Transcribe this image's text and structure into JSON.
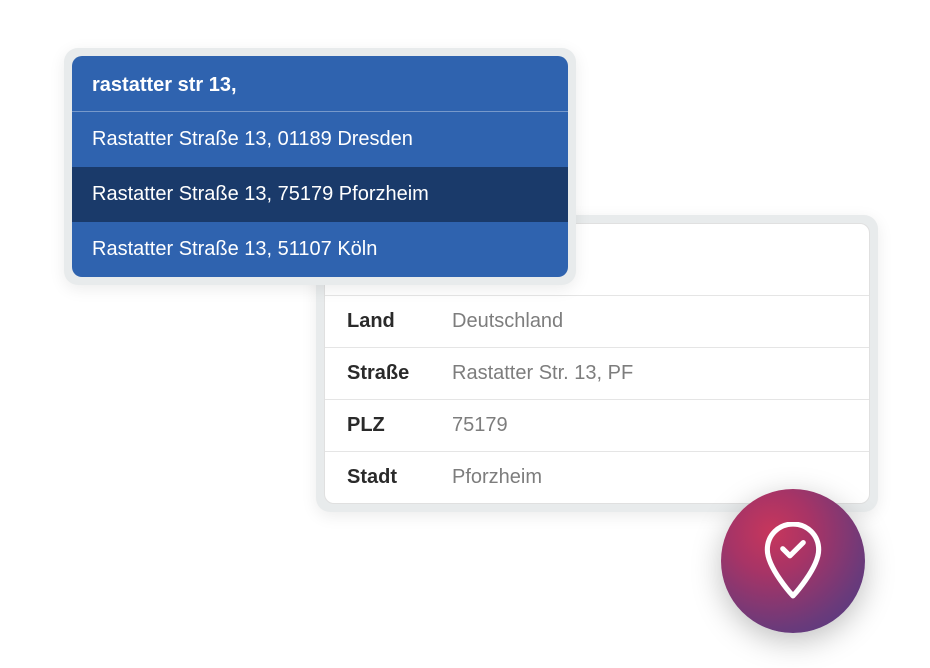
{
  "search": {
    "query": "rastatter str 13,",
    "suggestions": [
      {
        "text": "Rastatter Straße 13, 01189 Dresden",
        "selected": false
      },
      {
        "text": "Rastatter Straße 13, 75179 Pforzheim",
        "selected": true
      },
      {
        "text": "Rastatter Straße 13, 51107 Köln",
        "selected": false
      }
    ]
  },
  "details": {
    "rows": [
      {
        "label": "Land",
        "value": "Deutschland"
      },
      {
        "label": "Straße",
        "value": "Rastatter Str. 13, PF"
      },
      {
        "label": "PLZ",
        "value": "75179"
      },
      {
        "label": "Stadt",
        "value": "Pforzheim"
      }
    ]
  },
  "badge": {
    "icon": "location-check-icon"
  }
}
